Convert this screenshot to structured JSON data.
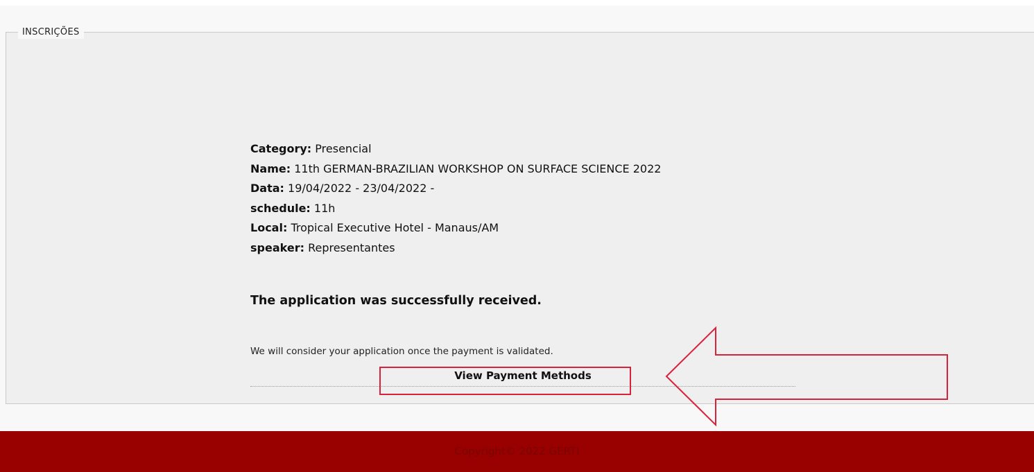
{
  "section": {
    "legend": "INSCRIÇÕES"
  },
  "details": [
    {
      "label": "Category:",
      "value": "Presencial"
    },
    {
      "label": "Name:",
      "value": "11th GERMAN-BRAZILIAN WORKSHOP ON SURFACE SCIENCE 2022"
    },
    {
      "label": "Data:",
      "value": "19/04/2022 - 23/04/2022 -"
    },
    {
      "label": "schedule:",
      "value": "11h"
    },
    {
      "label": "Local:",
      "value": "Tropical Executive Hotel - Manaus/AM"
    },
    {
      "label": "speaker:",
      "value": "Representantes"
    }
  ],
  "status": {
    "success_message": "The application was successfully received.",
    "note": "We will consider your application once the payment is validated.",
    "payment_link": "View Payment Methods"
  },
  "annotation": {
    "color": "#d9213b"
  },
  "footer": {
    "copyright": "Copyright© 2022 GERTI",
    "background": "#990000"
  }
}
